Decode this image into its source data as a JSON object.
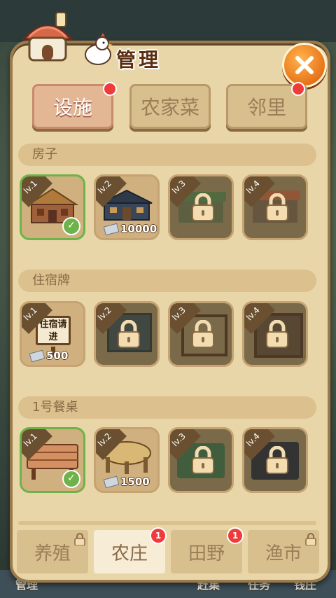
{
  "title": "管理",
  "category_tabs": [
    {
      "label": "设施",
      "active": true,
      "dot": true
    },
    {
      "label": "农家菜",
      "active": false,
      "dot": false
    },
    {
      "label": "邻里",
      "active": false,
      "dot": true
    }
  ],
  "sections": [
    {
      "title": "房子",
      "items": [
        {
          "level": "lv.1",
          "state": "owned",
          "price": ""
        },
        {
          "level": "lv.2",
          "state": "buy",
          "price": "10000"
        },
        {
          "level": "lv.3",
          "state": "locked",
          "price": ""
        },
        {
          "level": "lv.4",
          "state": "locked",
          "price": ""
        }
      ]
    },
    {
      "title": "住宿牌",
      "sign_text": "住宿请进",
      "items": [
        {
          "level": "lv.1",
          "state": "buy",
          "price": "500"
        },
        {
          "level": "lv.2",
          "state": "locked",
          "price": ""
        },
        {
          "level": "lv.3",
          "state": "locked",
          "price": ""
        },
        {
          "level": "lv.4",
          "state": "locked",
          "price": ""
        }
      ]
    },
    {
      "title": "1号餐桌",
      "items": [
        {
          "level": "lv.1",
          "state": "owned",
          "price": ""
        },
        {
          "level": "lv.2",
          "state": "buy",
          "price": "1500"
        },
        {
          "level": "lv.3",
          "state": "locked",
          "price": ""
        },
        {
          "level": "lv.4",
          "state": "locked",
          "price": ""
        }
      ]
    }
  ],
  "bottom_tabs": [
    {
      "label": "养殖",
      "active": false,
      "locked": true,
      "badge": ""
    },
    {
      "label": "农庄",
      "active": true,
      "locked": false,
      "badge": "1"
    },
    {
      "label": "田野",
      "active": false,
      "locked": false,
      "badge": "1"
    },
    {
      "label": "渔市",
      "active": false,
      "locked": true,
      "badge": ""
    }
  ],
  "background_labels": [
    "管理",
    "赶集",
    "任务",
    "钱庄"
  ],
  "icons": {
    "close": "close-icon",
    "lock": "lock-icon",
    "check": "check-icon",
    "ticket": "ticket-icon"
  },
  "colors": {
    "panel": "#e9d6a8",
    "accent": "#e8741a",
    "selected": "#6db34a",
    "badge": "#ef3b3b"
  }
}
